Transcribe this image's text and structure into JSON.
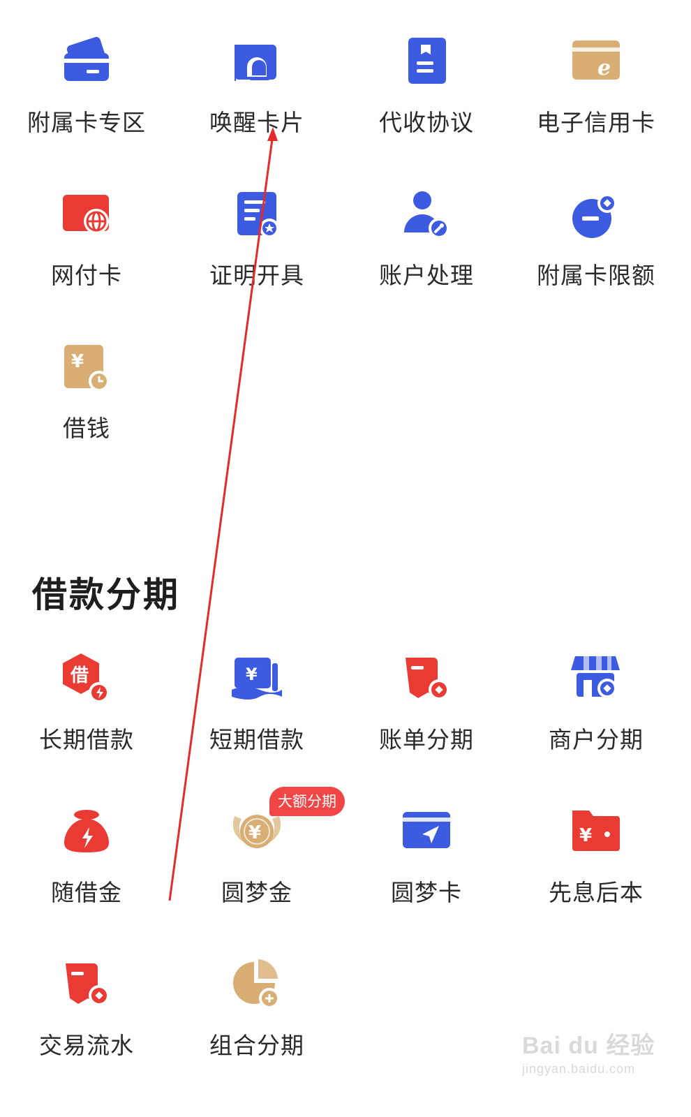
{
  "top_grid": [
    {
      "label": "附属卡专区",
      "icon": "card-icon"
    },
    {
      "label": "唤醒卡片",
      "icon": "bell-card-icon"
    },
    {
      "label": "代收协议",
      "icon": "document-icon"
    },
    {
      "label": "电子信用卡",
      "icon": "e-card-icon"
    },
    {
      "label": "网付卡",
      "icon": "web-pay-card-icon"
    },
    {
      "label": "证明开具",
      "icon": "certificate-icon"
    },
    {
      "label": "账户处理",
      "icon": "account-settings-icon"
    },
    {
      "label": "附属卡限额",
      "icon": "limit-icon"
    },
    {
      "label": "借钱",
      "icon": "borrow-money-icon"
    }
  ],
  "loan_section": {
    "title": "借款分期",
    "badge": "大额分期",
    "items": [
      {
        "label": "长期借款",
        "icon": "long-loan-icon"
      },
      {
        "label": "短期借款",
        "icon": "short-loan-icon"
      },
      {
        "label": "账单分期",
        "icon": "bill-installment-icon"
      },
      {
        "label": "商户分期",
        "icon": "merchant-installment-icon"
      },
      {
        "label": "随借金",
        "icon": "money-bag-icon"
      },
      {
        "label": "圆梦金",
        "icon": "dream-coin-icon"
      },
      {
        "label": "圆梦卡",
        "icon": "dream-card-icon"
      },
      {
        "label": "先息后本",
        "icon": "interest-first-icon"
      },
      {
        "label": "交易流水",
        "icon": "transaction-record-icon"
      },
      {
        "label": "组合分期",
        "icon": "combined-installment-icon"
      }
    ]
  },
  "watermark": {
    "main": "Bai du 经验",
    "sub": "jingyan.baidu.com"
  },
  "colors": {
    "blue": "#3d5be0",
    "red": "#ea3a34",
    "gold": "#d8ae74"
  }
}
